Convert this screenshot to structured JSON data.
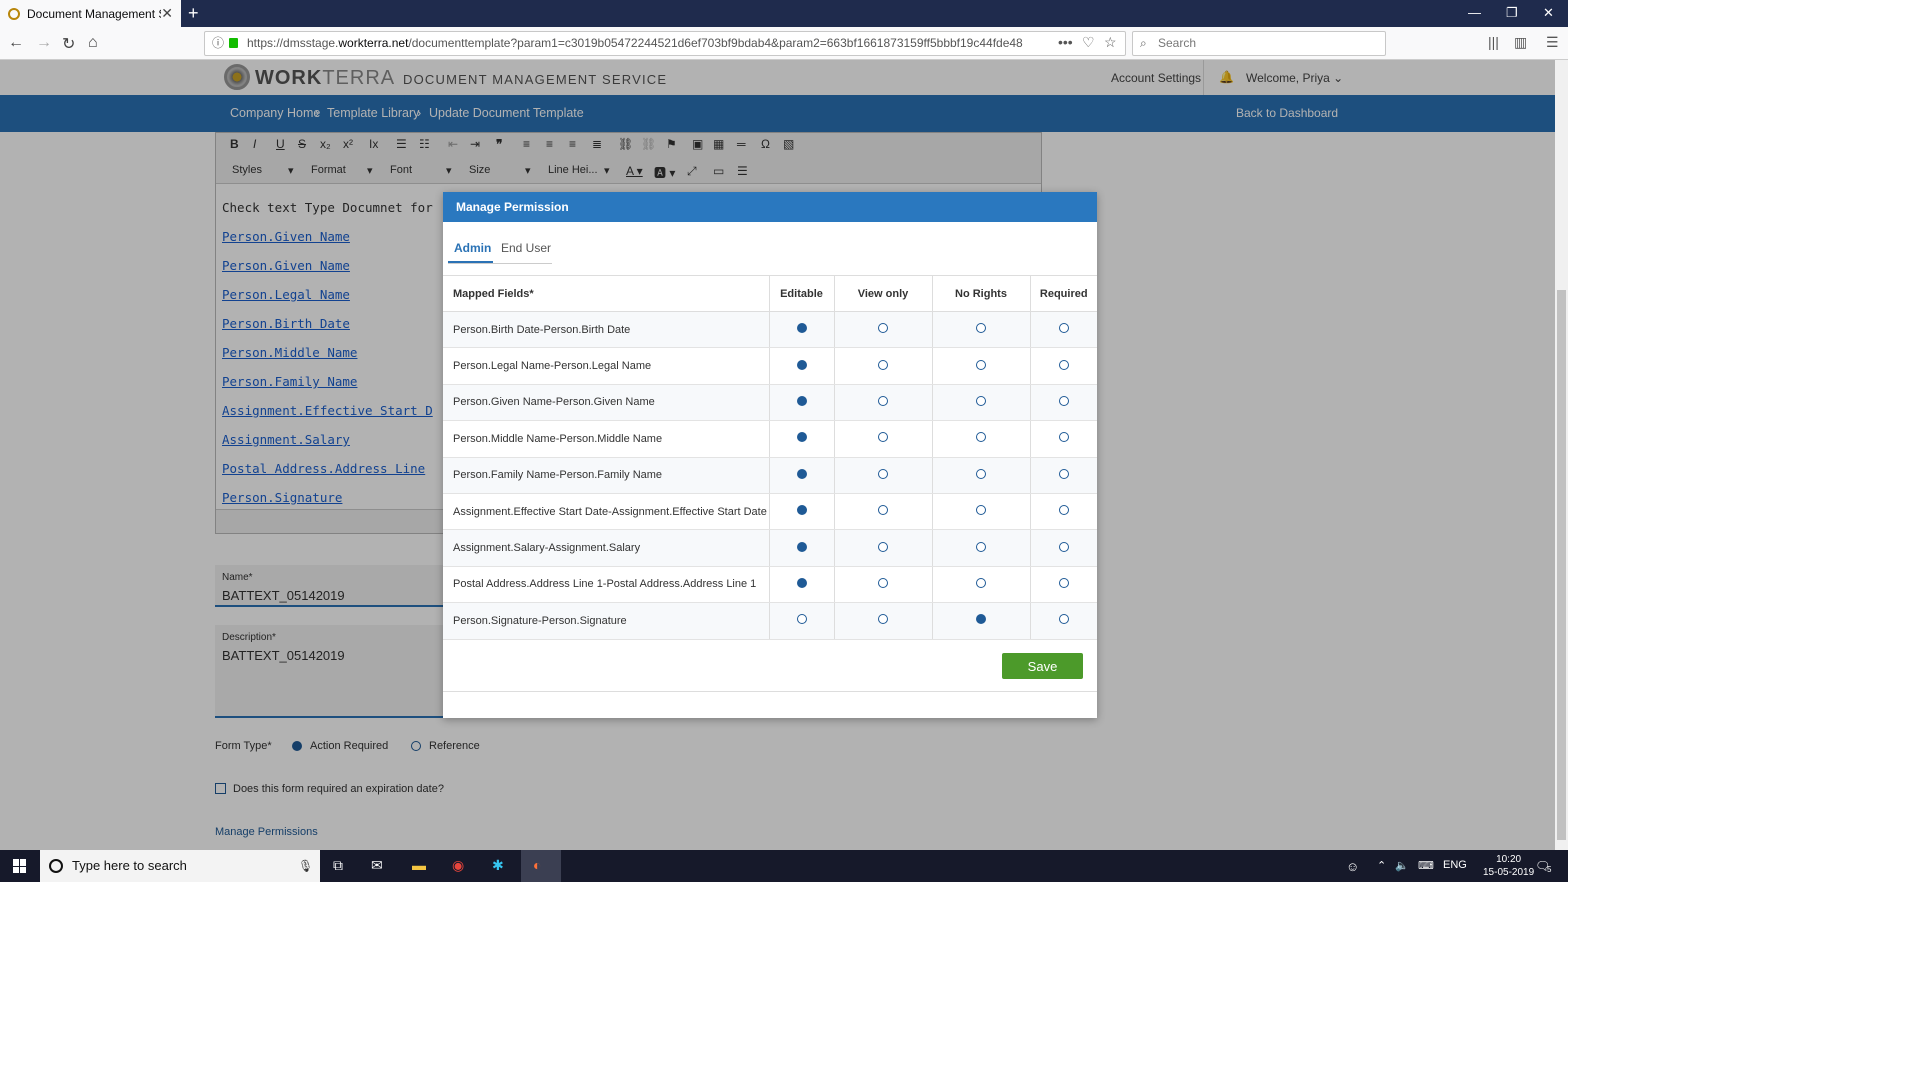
{
  "browser": {
    "tab_title": "Document Management Servic",
    "url_prefix": "https://dmsstage.",
    "url_domain": "workterra.net",
    "url_rest": "/documenttemplate?param1=c3019b05472244521d6ef703bf9bdab4&param2=663bf1661873159ff5bbbf19c44fde48",
    "search_placeholder": "Search"
  },
  "header": {
    "logo_bold": "WORK",
    "logo_light": "TERRA",
    "service_name": "DOCUMENT MANAGEMENT SERVICE",
    "account_settings": "Account Settings",
    "welcome": "Welcome, Priya"
  },
  "breadcrumb": {
    "items": [
      "Company Home",
      "Template Library",
      "Update Document Template"
    ],
    "back": "Back to Dashboard"
  },
  "editor": {
    "selects": [
      "Styles",
      "Format",
      "Font",
      "Size",
      "Line Hei..."
    ],
    "first_line": "Check text Type Documnet for",
    "links": [
      "Person.Given Name",
      "Person.Given Name",
      "Person.Legal Name",
      "Person.Birth Date",
      "Person.Middle Name",
      "Person.Family Name",
      "Assignment.Effective Start D",
      "Assignment.Salary",
      "Postal Address.Address Line",
      "Person.Signature"
    ]
  },
  "form": {
    "name_label": "Name*",
    "name_value": "BATTEXT_05142019",
    "desc_label": "Description*",
    "desc_value": "BATTEXT_05142019",
    "form_type_label": "Form Type*",
    "form_type_options": [
      "Action Required",
      "Reference"
    ],
    "form_type_selected": "Action Required",
    "expiration_label": "Does this form required an expiration date?",
    "manage_permissions": "Manage Permissions"
  },
  "modal": {
    "title": "Manage Permission",
    "tabs": [
      "Admin",
      "End User"
    ],
    "active_tab": "Admin",
    "columns": [
      "Mapped Fields*",
      "Editable",
      "View only",
      "No Rights",
      "Required"
    ],
    "rows": [
      {
        "field": "Person.Birth Date-Person.Birth Date",
        "selected": "Editable"
      },
      {
        "field": "Person.Legal Name-Person.Legal Name",
        "selected": "Editable"
      },
      {
        "field": "Person.Given Name-Person.Given Name",
        "selected": "Editable"
      },
      {
        "field": "Person.Middle Name-Person.Middle Name",
        "selected": "Editable"
      },
      {
        "field": "Person.Family Name-Person.Family Name",
        "selected": "Editable"
      },
      {
        "field": "Assignment.Effective Start Date-Assignment.Effective Start Date",
        "selected": "Editable"
      },
      {
        "field": "Assignment.Salary-Assignment.Salary",
        "selected": "Editable"
      },
      {
        "field": "Postal Address.Address Line 1-Postal Address.Address Line 1",
        "selected": "Editable"
      },
      {
        "field": "Person.Signature-Person.Signature",
        "selected": "No Rights"
      }
    ],
    "save_label": "Save"
  },
  "taskbar": {
    "search_placeholder": "Type here to search",
    "lang": "ENG",
    "time": "10:20",
    "date": "15-05-2019",
    "notif_count": "5"
  },
  "colors": {
    "brand_blue": "#2a72b5",
    "modal_header": "#2a78bf",
    "save_green": "#4c9a2a",
    "radio_blue": "#1f5a96"
  }
}
